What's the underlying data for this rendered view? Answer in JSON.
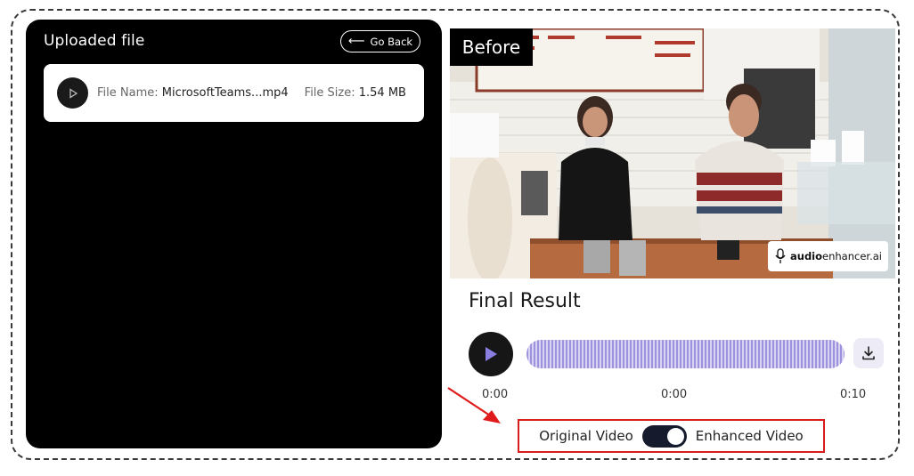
{
  "uploaded": {
    "title": "Uploaded file",
    "go_back": "Go Back",
    "file_name_label": "File Name:",
    "file_name": "MicrosoftTeams...mp4",
    "file_size_label": "File Size:",
    "file_size": "1.54 MB"
  },
  "video": {
    "badge": "Before",
    "watermark_bold": "audio",
    "watermark_rest": "enhancer.ai"
  },
  "result": {
    "title": "Final Result",
    "time_start": "0:00",
    "time_current": "0:00",
    "time_end": "0:10",
    "waveform_color": "#9d92dc"
  },
  "toggle": {
    "left_label": "Original Video",
    "right_label": "Enhanced Video",
    "state": "enhanced"
  },
  "colors": {
    "accent": "#8a7fe0",
    "highlight": "#d91c1c"
  }
}
